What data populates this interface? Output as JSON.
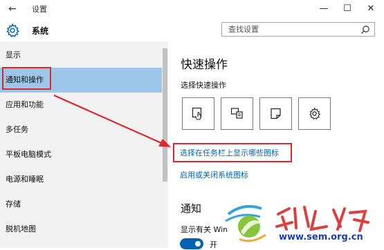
{
  "window": {
    "title": "设置",
    "back_glyph": "←",
    "minimize_glyph": "—",
    "maximize_glyph": "☐",
    "close_glyph": "✕"
  },
  "header": {
    "icon": "gear-icon",
    "title": "系统"
  },
  "search": {
    "placeholder": "查找设置",
    "icon": "search-icon"
  },
  "sidebar": {
    "selected_index": 1,
    "selected_color": "#9cc6ea",
    "items": [
      {
        "label": "显示"
      },
      {
        "label": "通知和操作"
      },
      {
        "label": "应用和功能"
      },
      {
        "label": "多任务"
      },
      {
        "label": "平板电脑模式"
      },
      {
        "label": "电源和睡眠"
      },
      {
        "label": "存储"
      },
      {
        "label": "脱机地图"
      }
    ]
  },
  "content": {
    "title": "快速操作",
    "subtitle": "选择快速操作",
    "quick_actions": [
      {
        "icon": "tablet-mode-icon"
      },
      {
        "icon": "project-icon"
      },
      {
        "icon": "note-icon"
      },
      {
        "icon": "settings-gear-icon"
      }
    ],
    "link_taskbar_icons": "选择在任务栏上显示哪些图标",
    "link_system_icons": "启用或关闭系统图标",
    "notify_section": "通知",
    "notify_show_label": "显示有关 Win",
    "toggle_label": "开",
    "toggle_on": true,
    "link_color": "#0063b1"
  },
  "annotations": {
    "highlight_color": "#e0262b"
  },
  "watermark": {
    "site": "www.sem.org.cn"
  }
}
